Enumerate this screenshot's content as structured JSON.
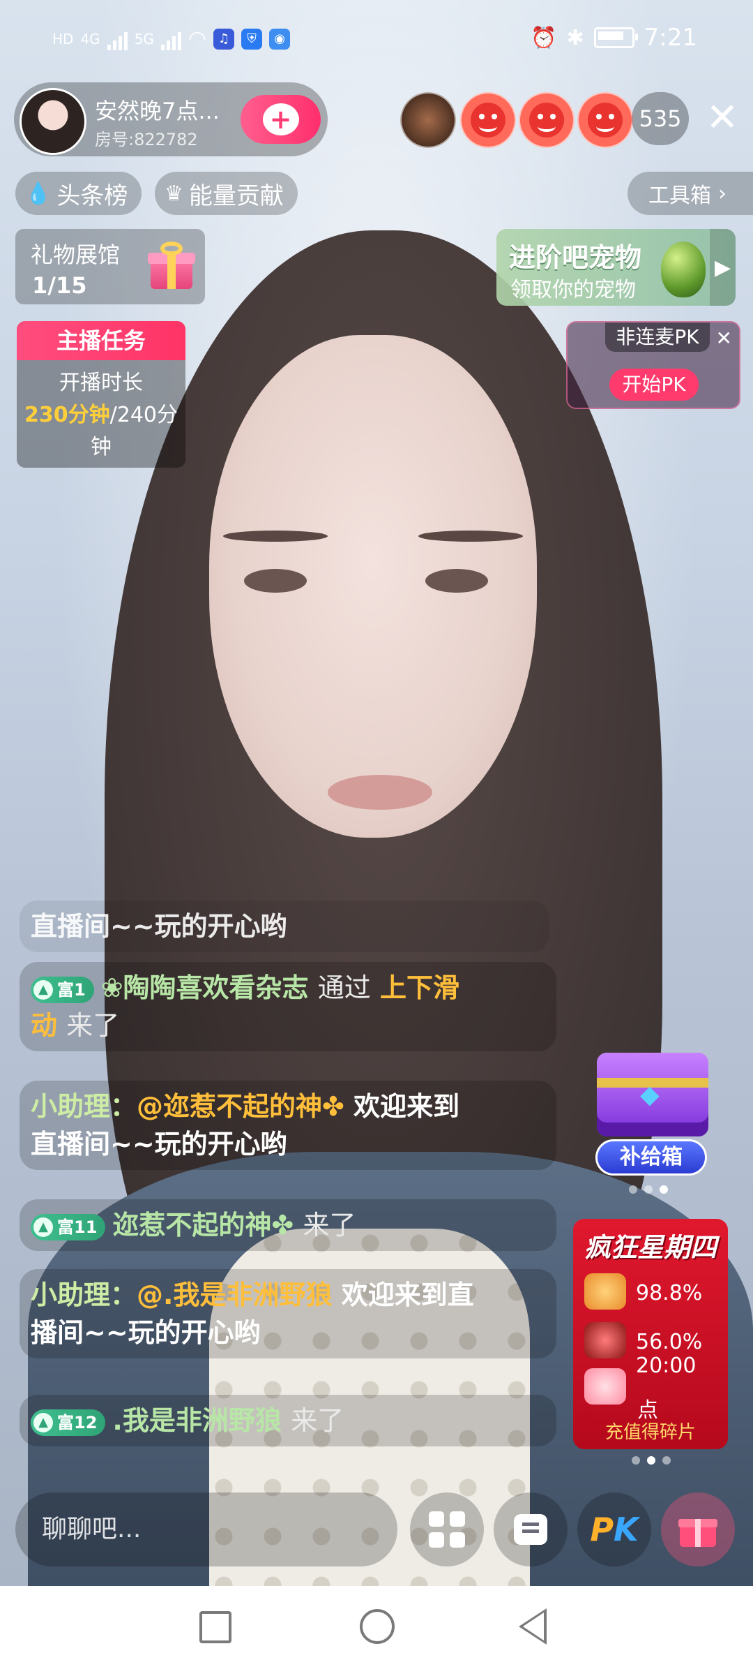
{
  "status_bar": {
    "left_labels": [
      "HD",
      "4G",
      "5G"
    ],
    "time": "7:21",
    "icons": [
      "signal-icon",
      "wifi-icon",
      "music-app-icon",
      "shield-app-icon",
      "browser-app-icon",
      "alarm-icon",
      "bluetooth-icon",
      "battery-icon"
    ]
  },
  "host": {
    "name": "安然晚7点...",
    "room": "房号:822782",
    "follow_icon": "+"
  },
  "viewers": {
    "count": "535"
  },
  "chips": {
    "rank": "头条榜",
    "energy": "能量贡献",
    "toolbox": "工具箱"
  },
  "gift_gallery": {
    "title": "礼物展馆",
    "count": "1/15"
  },
  "pet_banner": {
    "title": "进阶吧宠物",
    "subtitle": "领取你的宠物"
  },
  "pk_card": {
    "label": "非连麦PK",
    "start": "开始PK"
  },
  "task_card": {
    "title": "主播任务",
    "label": "开播时长",
    "progress": "230分钟",
    "total": "/240分",
    "unit_tail": "钟",
    "progress_fraction": 0.958
  },
  "chat": {
    "top_fragment": "直播间~~玩的开心哟",
    "messages": [
      {
        "badge": "富1",
        "user": "❀陶陶喜欢看杂志",
        "via": "通过",
        "method": "上下滑",
        "method2": "动",
        "tail": "来了"
      },
      {
        "bot": "小助理：",
        "mention": "@迩惹不起的神✤",
        "text1": "欢迎来到",
        "text2": "直播间~~玩的开心哟"
      },
      {
        "badge": "富11",
        "user": "迩惹不起的神✤",
        "tail": "来了"
      },
      {
        "bot": "小助理：",
        "mention": "@.我是非洲野狼",
        "text1": "欢迎来到直",
        "text2": "播间~~玩的开心哟"
      },
      {
        "badge": "富12",
        "user": ".我是非洲野狼",
        "tail": "来了"
      }
    ]
  },
  "supply_box": {
    "label": "补给箱"
  },
  "promo": {
    "title": "疯狂星期四",
    "row1": "98.8%",
    "row2": "56.0%",
    "row3": "20:00",
    "row4": "点",
    "footer": "充值得碎片"
  },
  "bottom_bar": {
    "input_placeholder": "聊聊吧...",
    "pk_label_p": "P",
    "pk_label_k": "K"
  },
  "colors": {
    "accent_pink": "#ff3366",
    "gold": "#ffcf3a",
    "badge_green": "#2fa476"
  }
}
